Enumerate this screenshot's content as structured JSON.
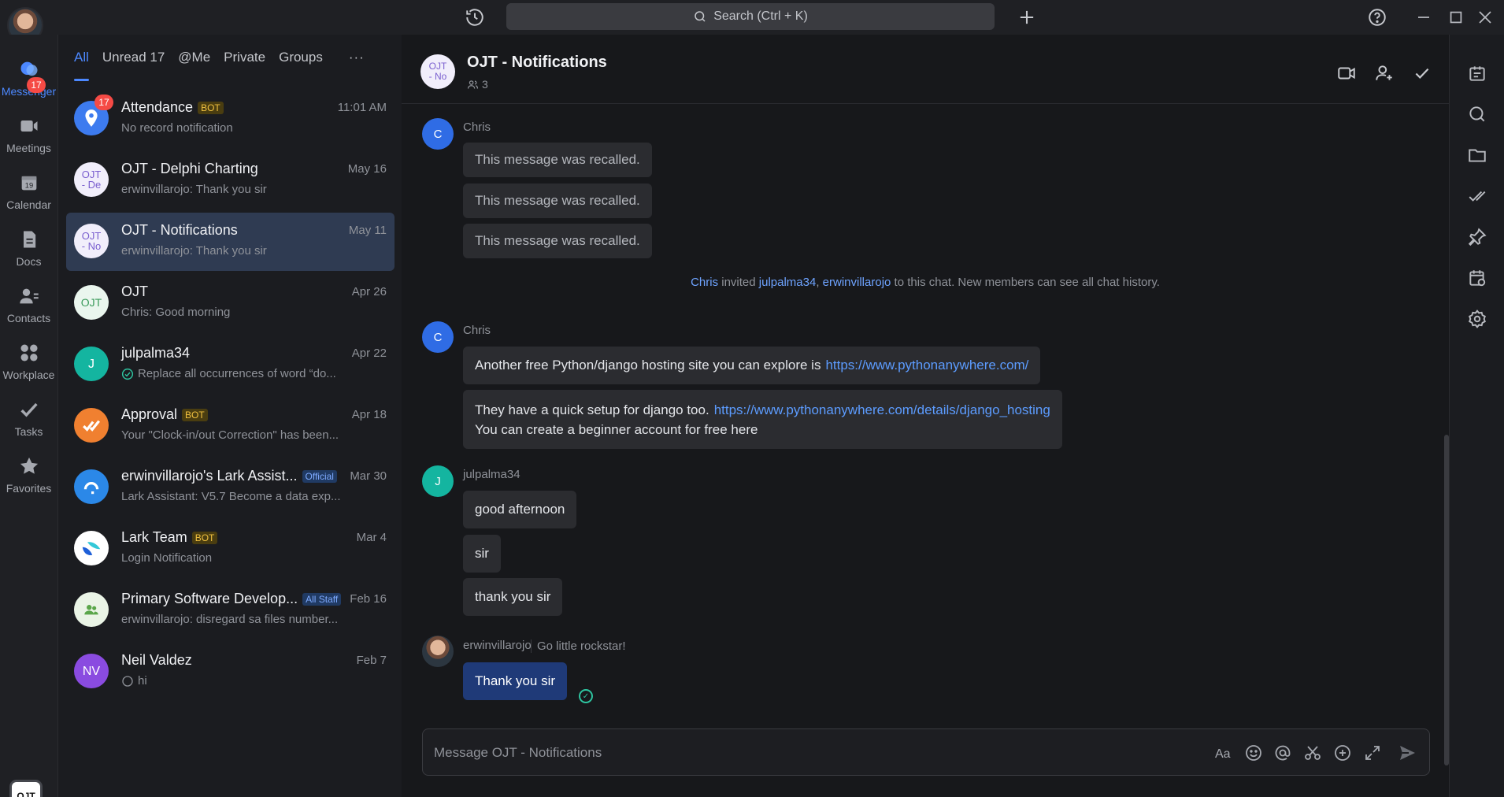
{
  "topbar": {
    "search_placeholder": "Search (Ctrl + K)"
  },
  "rail": {
    "items": [
      {
        "label": "Messenger",
        "badge": "17"
      },
      {
        "label": "Meetings"
      },
      {
        "label": "Calendar",
        "day": "19"
      },
      {
        "label": "Docs"
      },
      {
        "label": "Contacts"
      },
      {
        "label": "Workplace"
      },
      {
        "label": "Tasks"
      },
      {
        "label": "Favorites"
      }
    ],
    "org_label": "OJT"
  },
  "list": {
    "tabs": [
      "All",
      "Unread 17",
      "@Me",
      "Private",
      "Groups",
      "···"
    ],
    "chats": [
      {
        "name": "Attendance",
        "tag": "BOT",
        "date": "11:01 AM",
        "preview": "No record notification",
        "badge": "17"
      },
      {
        "name": "OJT - Delphi Charting",
        "date": "May 16",
        "preview": "erwinvillarojo: Thank you sir",
        "avatar": "OJT\n- De"
      },
      {
        "name": "OJT - Notifications",
        "date": "May 11",
        "preview": "erwinvillarojo: Thank you sir",
        "avatar": "OJT\n- No"
      },
      {
        "name": "OJT",
        "date": "Apr 26",
        "preview": "Chris: Good morning",
        "avatar": "OJT"
      },
      {
        "name": "julpalma34",
        "date": "Apr 22",
        "preview": "Replace all occurrences of word “do...",
        "avatar": "J"
      },
      {
        "name": "Approval",
        "tag": "BOT",
        "date": "Apr 18",
        "preview": "Your \"Clock-in/out Correction\" has been..."
      },
      {
        "name": "erwinvillarojo's Lark Assist...",
        "tag": "Official",
        "date": "Mar 30",
        "preview": "Lark Assistant: V5.7 Become a data exp..."
      },
      {
        "name": "Lark Team",
        "tag": "BOT",
        "date": "Mar 4",
        "preview": "Login Notification"
      },
      {
        "name": "Primary Software Develop...",
        "tag": "All Staff",
        "date": "Feb 16",
        "preview": "erwinvillarojo: disregard sa files number..."
      },
      {
        "name": "Neil Valdez",
        "date": "Feb 7",
        "preview": "hi",
        "avatar": "NV"
      }
    ]
  },
  "chat": {
    "title": "OJT - Notifications",
    "avatar": "OJT\n- No",
    "members": "3",
    "messages": {
      "sender1": "Chris",
      "avatar1": "C",
      "recalled": "This message was recalled.",
      "sys_user1": "Chris",
      "sys_invited": "invited",
      "sys_user2": "julpalma34",
      "sys_comma": ",",
      "sys_user3": "erwinvillarojo",
      "sys_rest": "to this chat. New members can see all chat history.",
      "sender2": "Chris",
      "avatar2": "C",
      "msg1_text": "Another free Python/django hosting site you can explore is",
      "msg1_link": "https://www.pythonanywhere.com/",
      "msg2_text": "They have a quick setup for django too.",
      "msg2_link": "https://www.pythonanywhere.com/details/django_hosting",
      "msg2_line2": "You can create a beginner account for free here",
      "sender3": "julpalma34",
      "avatar3": "J",
      "msg3": "good afternoon",
      "msg4": "sir",
      "msg5": "thank you sir",
      "sender4": "erwinvillarojo",
      "sender4_status": "Go little rockstar!",
      "msg6": "Thank you sir"
    },
    "composer_placeholder": "Message OJT - Notifications"
  },
  "colors": {
    "accent": "#4c88ff",
    "badge": "#f54a45",
    "self_bubble": "#1f3a78",
    "selected_row": "#2f3b52"
  }
}
